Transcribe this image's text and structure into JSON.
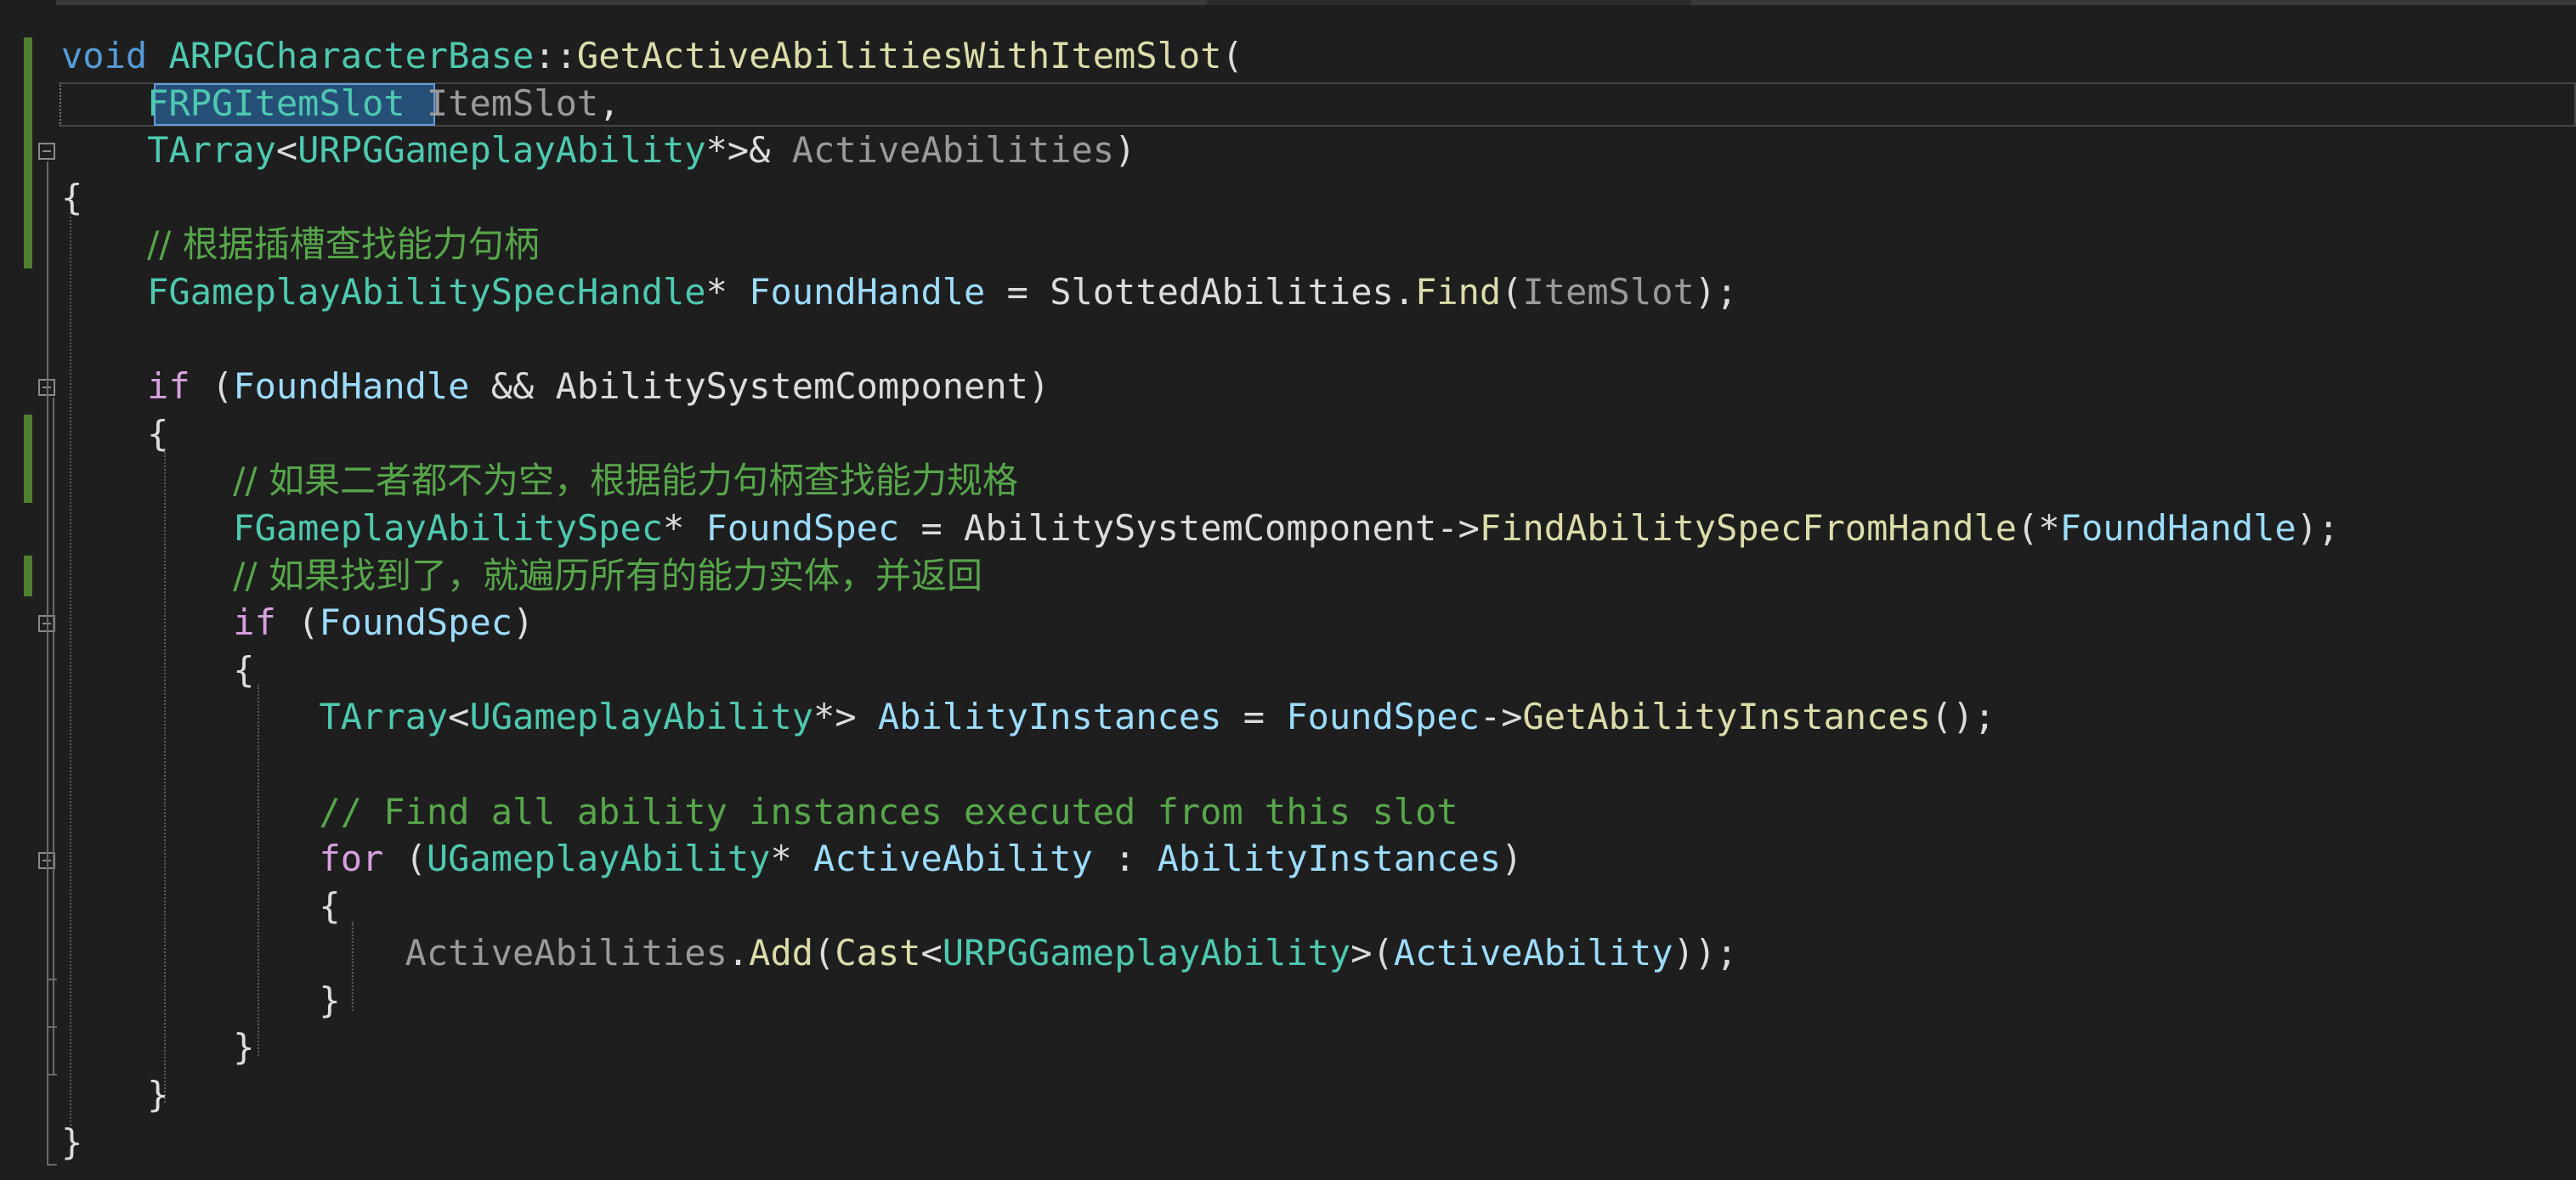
{
  "colors": {
    "background": "#1e1e1e",
    "keyword": "#569cd6",
    "control": "#d8a0df",
    "type": "#4ec9b0",
    "function": "#dcdcaa",
    "variable": "#9cdcfe",
    "parameter": "#9a9a9a",
    "comment": "#57a64a",
    "text": "#dcdcdc",
    "change_bar": "#4f7f2f",
    "selection": "#264f78"
  },
  "code": {
    "lines": [
      [
        {
          "t": "void",
          "c": "keyword"
        },
        {
          "t": " ",
          "c": "text"
        },
        {
          "t": "ARPGCharacterBase",
          "c": "type"
        },
        {
          "t": "::",
          "c": "text"
        },
        {
          "t": "GetActiveAbilitiesWithItemSlot",
          "c": "function"
        },
        {
          "t": "(",
          "c": "text"
        }
      ],
      [
        {
          "t": "    ",
          "c": "text"
        },
        {
          "t": "FRPGItemSlot",
          "c": "type"
        },
        {
          "t": " ",
          "c": "text"
        },
        {
          "t": "ItemSlot",
          "c": "parameter"
        },
        {
          "t": ",",
          "c": "text"
        }
      ],
      [
        {
          "t": "    ",
          "c": "text"
        },
        {
          "t": "TArray",
          "c": "type"
        },
        {
          "t": "<",
          "c": "text"
        },
        {
          "t": "URPGGameplayAbility",
          "c": "type"
        },
        {
          "t": "*>& ",
          "c": "text"
        },
        {
          "t": "ActiveAbilities",
          "c": "parameter"
        },
        {
          "t": ")",
          "c": "text"
        }
      ],
      [
        {
          "t": "{",
          "c": "text"
        }
      ],
      [
        {
          "t": "    ",
          "c": "text"
        },
        {
          "t": "// 根据插槽查找能力句柄",
          "c": "comment",
          "cjk": true
        }
      ],
      [
        {
          "t": "    ",
          "c": "text"
        },
        {
          "t": "FGameplayAbilitySpecHandle",
          "c": "type"
        },
        {
          "t": "* ",
          "c": "text"
        },
        {
          "t": "FoundHandle",
          "c": "variable"
        },
        {
          "t": " = ",
          "c": "text"
        },
        {
          "t": "SlottedAbilities",
          "c": "text"
        },
        {
          "t": ".",
          "c": "text"
        },
        {
          "t": "Find",
          "c": "function"
        },
        {
          "t": "(",
          "c": "text"
        },
        {
          "t": "ItemSlot",
          "c": "parameter"
        },
        {
          "t": ");",
          "c": "text"
        }
      ],
      [],
      [
        {
          "t": "    ",
          "c": "text"
        },
        {
          "t": "if",
          "c": "control"
        },
        {
          "t": " (",
          "c": "text"
        },
        {
          "t": "FoundHandle",
          "c": "variable"
        },
        {
          "t": " && ",
          "c": "text"
        },
        {
          "t": "AbilitySystemComponent",
          "c": "text"
        },
        {
          "t": ")",
          "c": "text"
        }
      ],
      [
        {
          "t": "    {",
          "c": "text"
        }
      ],
      [
        {
          "t": "        ",
          "c": "text"
        },
        {
          "t": "// 如果二者都不为空，根据能力句柄查找能力规格",
          "c": "comment",
          "cjk": true
        }
      ],
      [
        {
          "t": "        ",
          "c": "text"
        },
        {
          "t": "FGameplayAbilitySpec",
          "c": "type"
        },
        {
          "t": "* ",
          "c": "text"
        },
        {
          "t": "FoundSpec",
          "c": "variable"
        },
        {
          "t": " = ",
          "c": "text"
        },
        {
          "t": "AbilitySystemComponent",
          "c": "text"
        },
        {
          "t": "->",
          "c": "text"
        },
        {
          "t": "FindAbilitySpecFromHandle",
          "c": "function"
        },
        {
          "t": "(*",
          "c": "text"
        },
        {
          "t": "FoundHandle",
          "c": "variable"
        },
        {
          "t": ");",
          "c": "text"
        }
      ],
      [
        {
          "t": "        ",
          "c": "text"
        },
        {
          "t": "// 如果找到了，就遍历所有的能力实体，并返回",
          "c": "comment",
          "cjk": true
        }
      ],
      [
        {
          "t": "        ",
          "c": "text"
        },
        {
          "t": "if",
          "c": "control"
        },
        {
          "t": " (",
          "c": "text"
        },
        {
          "t": "FoundSpec",
          "c": "variable"
        },
        {
          "t": ")",
          "c": "text"
        }
      ],
      [
        {
          "t": "        {",
          "c": "text"
        }
      ],
      [
        {
          "t": "            ",
          "c": "text"
        },
        {
          "t": "TArray",
          "c": "type"
        },
        {
          "t": "<",
          "c": "text"
        },
        {
          "t": "UGameplayAbility",
          "c": "type"
        },
        {
          "t": "*> ",
          "c": "text"
        },
        {
          "t": "AbilityInstances",
          "c": "variable"
        },
        {
          "t": " = ",
          "c": "text"
        },
        {
          "t": "FoundSpec",
          "c": "variable"
        },
        {
          "t": "->",
          "c": "text"
        },
        {
          "t": "GetAbilityInstances",
          "c": "function"
        },
        {
          "t": "();",
          "c": "text"
        }
      ],
      [],
      [
        {
          "t": "            ",
          "c": "text"
        },
        {
          "t": "// Find all ability instances executed from this slot",
          "c": "comment"
        }
      ],
      [
        {
          "t": "            ",
          "c": "text"
        },
        {
          "t": "for",
          "c": "control"
        },
        {
          "t": " (",
          "c": "text"
        },
        {
          "t": "UGameplayAbility",
          "c": "type"
        },
        {
          "t": "* ",
          "c": "text"
        },
        {
          "t": "ActiveAbility",
          "c": "variable"
        },
        {
          "t": " : ",
          "c": "text"
        },
        {
          "t": "AbilityInstances",
          "c": "variable"
        },
        {
          "t": ")",
          "c": "text"
        }
      ],
      [
        {
          "t": "            {",
          "c": "text"
        }
      ],
      [
        {
          "t": "                ",
          "c": "text"
        },
        {
          "t": "ActiveAbilities",
          "c": "parameter"
        },
        {
          "t": ".",
          "c": "text"
        },
        {
          "t": "Add",
          "c": "function"
        },
        {
          "t": "(",
          "c": "text"
        },
        {
          "t": "Cast",
          "c": "function"
        },
        {
          "t": "<",
          "c": "text"
        },
        {
          "t": "URPGGameplayAbility",
          "c": "type"
        },
        {
          "t": ">(",
          "c": "text"
        },
        {
          "t": "ActiveAbility",
          "c": "variable"
        },
        {
          "t": "));",
          "c": "text"
        }
      ],
      [
        {
          "t": "            }",
          "c": "text"
        }
      ],
      [
        {
          "t": "        }",
          "c": "text"
        }
      ],
      [
        {
          "t": "    }",
          "c": "text"
        }
      ],
      [
        {
          "t": "}",
          "c": "text"
        }
      ]
    ]
  }
}
